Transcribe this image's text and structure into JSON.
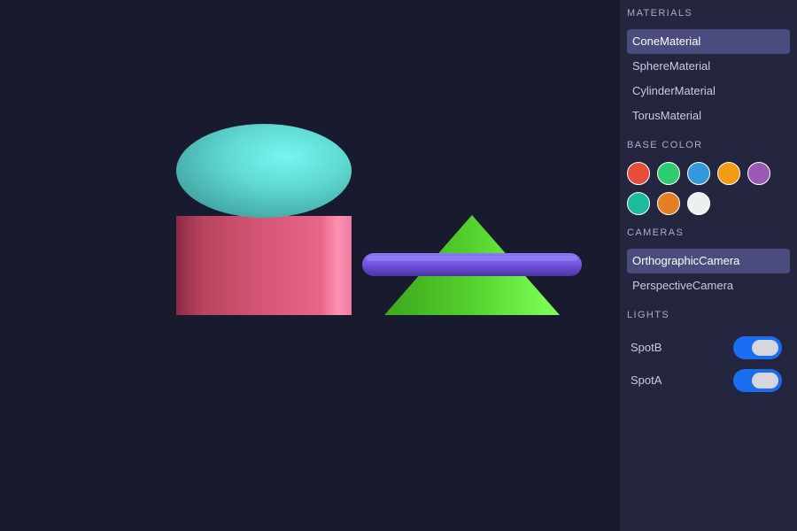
{
  "panel": {
    "materials_title": "MATERIALS",
    "materials": [
      {
        "label": "ConeMaterial",
        "selected": true
      },
      {
        "label": "SphereMaterial",
        "selected": false
      },
      {
        "label": "CylinderMaterial",
        "selected": false
      },
      {
        "label": "TorusMaterial",
        "selected": false
      }
    ],
    "base_color_title": "BASE COLOR",
    "base_colors": [
      "#e74c3c",
      "#2ecc71",
      "#3498db",
      "#f39c12",
      "#9b59b6",
      "#1abc9c",
      "#e67e22",
      "#ecf0f1"
    ],
    "cameras_title": "CAMERAS",
    "cameras": [
      {
        "label": "OrthographicCamera",
        "selected": true
      },
      {
        "label": "PerspectiveCamera",
        "selected": false
      }
    ],
    "lights_title": "LIGHTS",
    "lights": [
      {
        "label": "SpotB",
        "enabled": true
      },
      {
        "label": "SpotA",
        "enabled": true
      }
    ]
  },
  "scene": {
    "objects": [
      {
        "name": "sphere",
        "color": "#5fe0d8"
      },
      {
        "name": "cylinder",
        "color": "#e05a80"
      },
      {
        "name": "cone",
        "color": "#5ed834"
      },
      {
        "name": "torus",
        "color": "#7a5ae6"
      }
    ]
  },
  "colors": {
    "viewport_bg": "#181a2e",
    "panel_bg": "#24253f",
    "selected_bg": "#4b4c7e",
    "toggle_on": "#1a6cf0"
  }
}
